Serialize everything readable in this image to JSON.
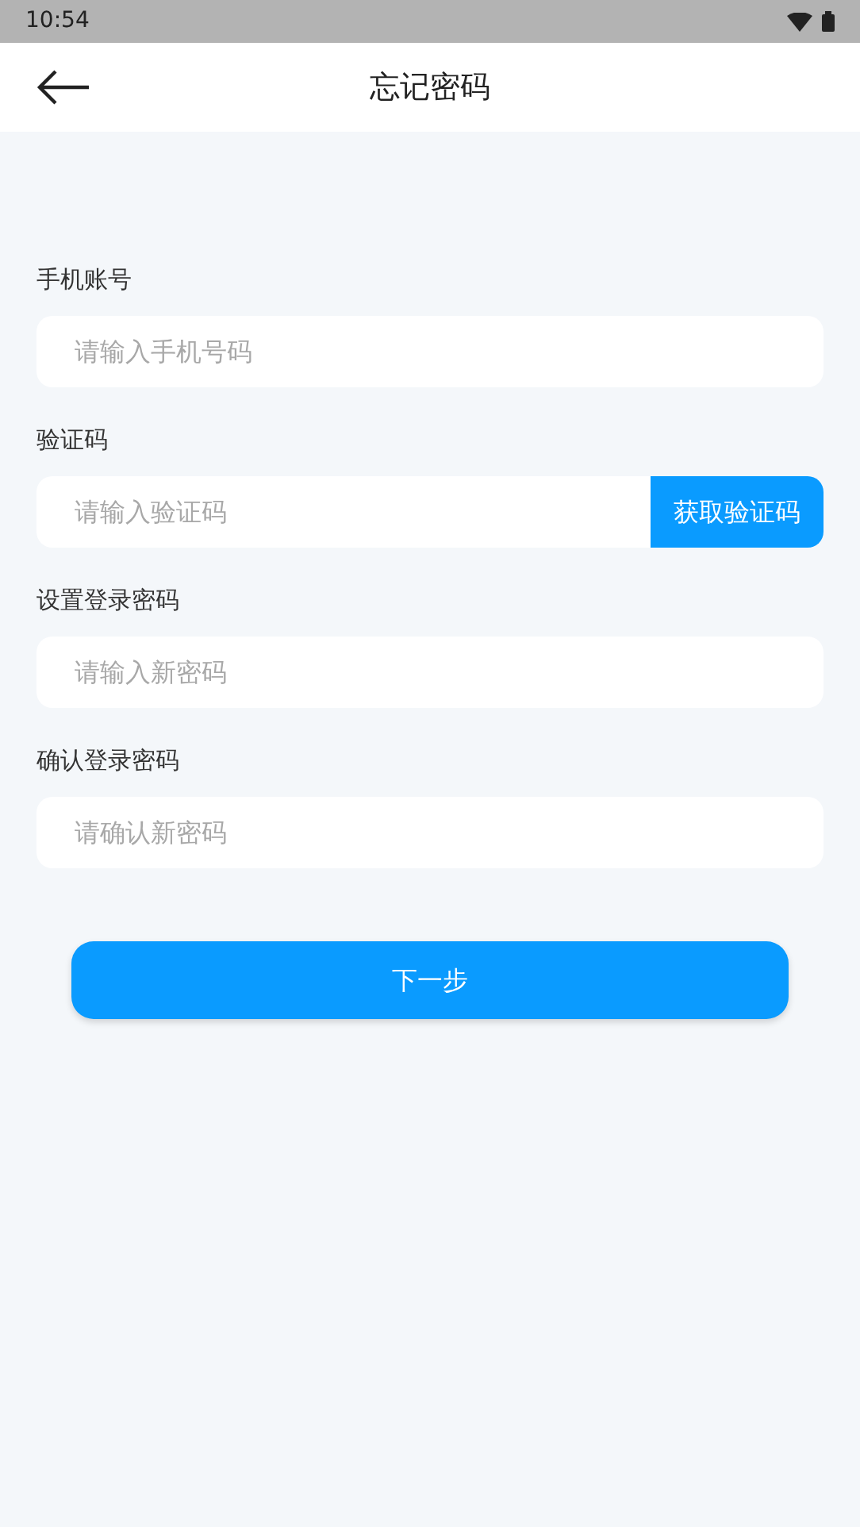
{
  "status_bar": {
    "time": "10:54"
  },
  "header": {
    "title": "忘记密码"
  },
  "fields": [
    {
      "kind": "text",
      "label": "手机账号",
      "placeholder": "请输入手机号码"
    },
    {
      "kind": "code",
      "label": "验证码",
      "placeholder": "请输入验证码",
      "button": "获取验证码"
    },
    {
      "kind": "text",
      "label": "设置登录密码",
      "placeholder": "请输入新密码"
    },
    {
      "kind": "text",
      "label": "确认登录密码",
      "placeholder": "请确认新密码"
    }
  ],
  "next_button": "下一步"
}
